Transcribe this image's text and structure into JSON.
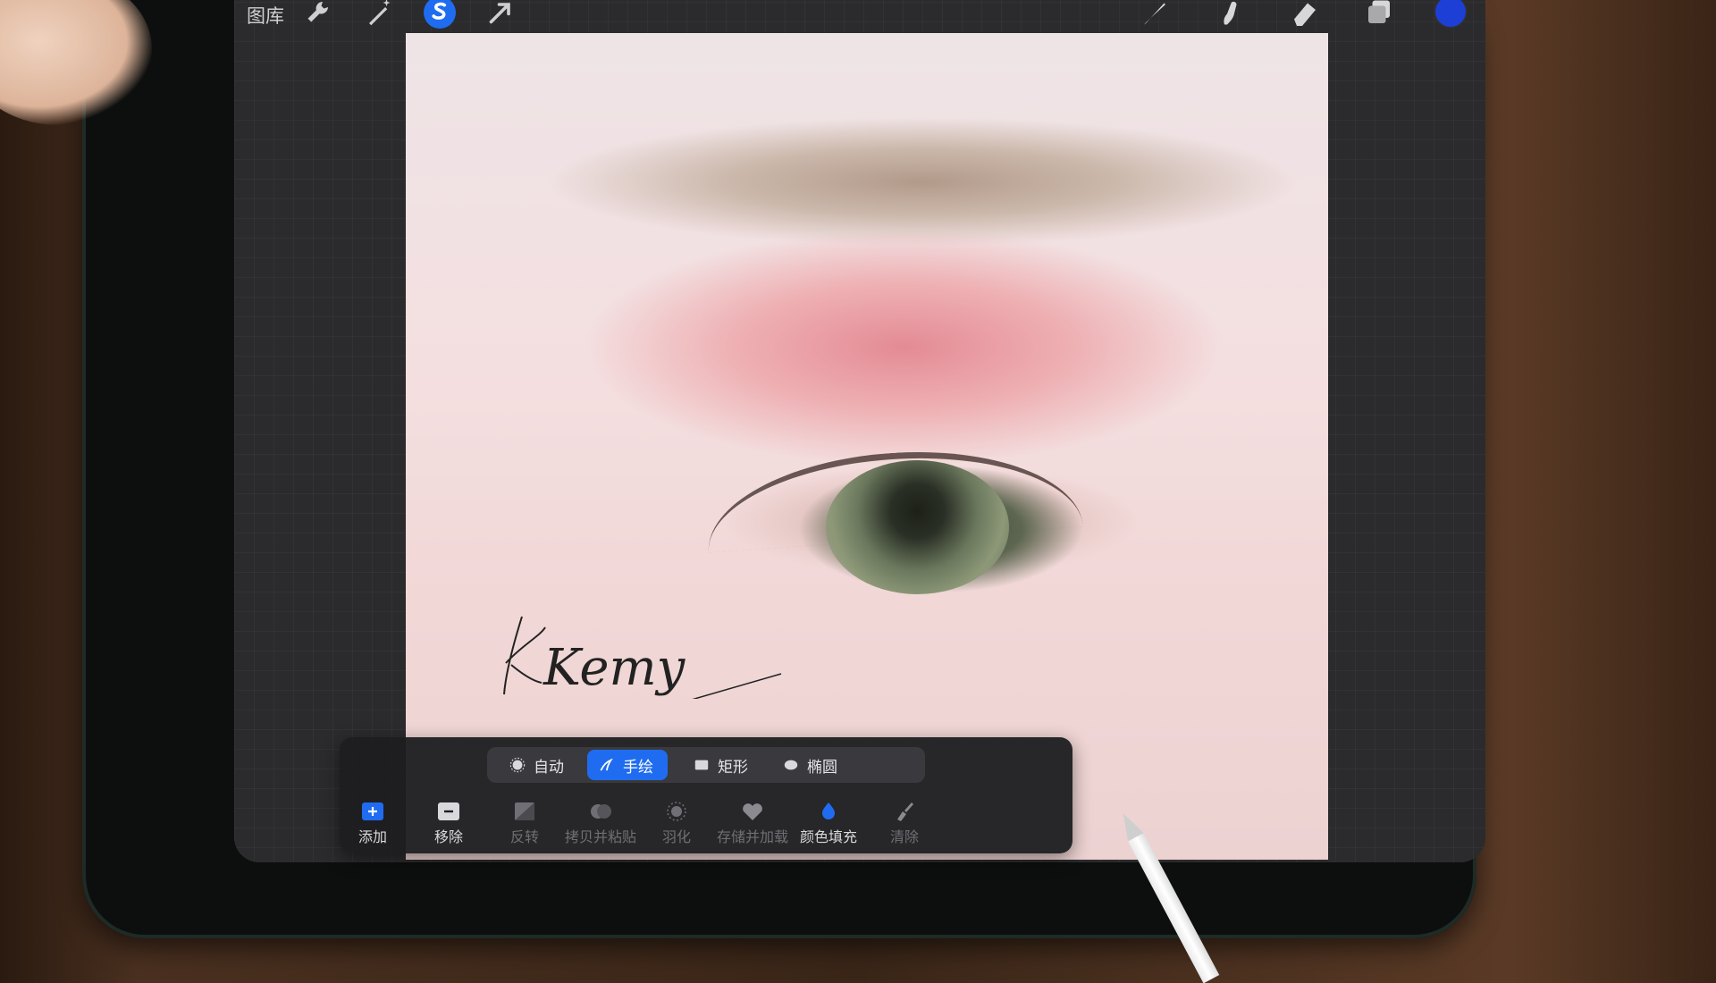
{
  "topbar": {
    "gallery_label": "图库",
    "tools": [
      "wrench-icon",
      "magic-wand-icon",
      "selection-icon",
      "transform-icon",
      "brush-icon",
      "smudge-icon",
      "eraser-icon",
      "layers-icon"
    ],
    "color": "#1d3fd6"
  },
  "canvas": {
    "signature_text": "Kemy"
  },
  "selection": {
    "modes": [
      {
        "label": "自动",
        "icon": "auto-icon"
      },
      {
        "label": "手绘",
        "icon": "freehand-icon",
        "active": true
      },
      {
        "label": "矩形",
        "icon": "rectangle-icon"
      },
      {
        "label": "椭圆",
        "icon": "ellipse-icon"
      }
    ],
    "actions": [
      {
        "label": "添加",
        "icon": "add-icon",
        "state": "active"
      },
      {
        "label": "移除",
        "icon": "remove-icon",
        "state": "active"
      },
      {
        "label": "反转",
        "icon": "invert-icon",
        "state": "dim"
      },
      {
        "label": "拷贝并粘贴",
        "icon": "copy-paste-icon",
        "state": "dim"
      },
      {
        "label": "羽化",
        "icon": "feather-icon",
        "state": "dim"
      },
      {
        "label": "存储并加载",
        "icon": "save-load-icon",
        "state": "dim"
      },
      {
        "label": "颜色填充",
        "icon": "color-fill-icon",
        "state": "active"
      },
      {
        "label": "清除",
        "icon": "clear-icon",
        "state": "dim"
      }
    ]
  },
  "colors": {
    "accent": "#1f6cf0",
    "panel": "#1e1e21"
  }
}
